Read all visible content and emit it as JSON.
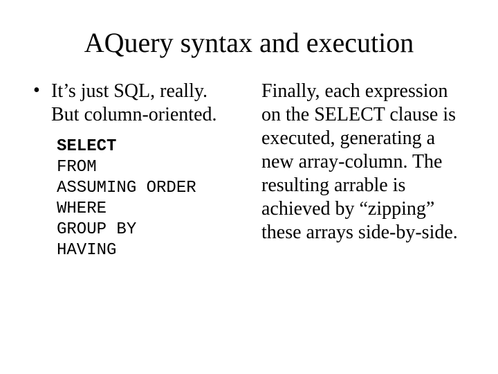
{
  "title": "AQuery syntax and execution",
  "left": {
    "bullet_text": "It’s just SQL, really. But column-oriented.",
    "code": {
      "select": "SELECT",
      "lines": [
        "FROM",
        "ASSUMING ORDER",
        "WHERE",
        "GROUP BY",
        "HAVING"
      ]
    }
  },
  "right": {
    "paragraph": "Finally, each expression on the SELECT clause is executed, generating a new array-column. The resulting arrable is achieved by “zipping” these arrays side-by-side."
  }
}
